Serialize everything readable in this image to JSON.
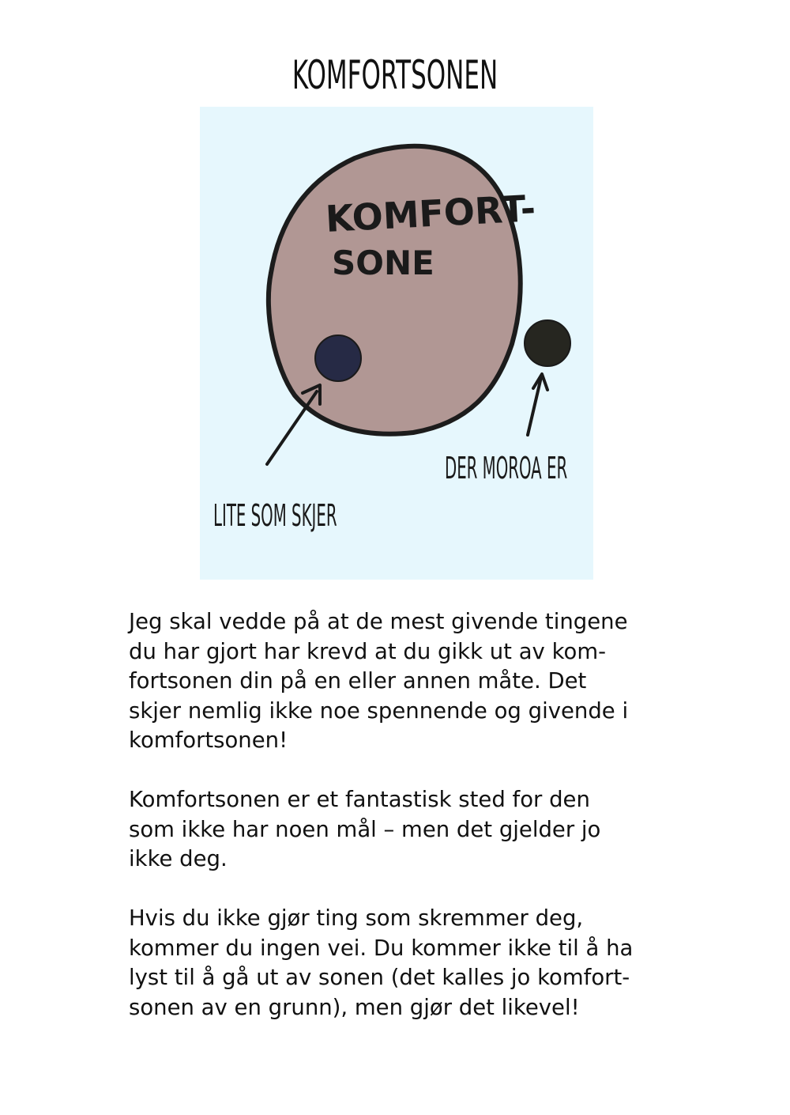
{
  "page": {
    "title": "KOMFORTSONEN"
  },
  "diagram": {
    "background_color": "#e6f7fd",
    "zone_fill_color": "#b19794",
    "zone_label_line1": "KOMFORT-",
    "zone_label_line2": "SONE",
    "inner_dot_color": "#262a45",
    "outer_dot_color": "#262620",
    "label_inside": "LITE SOM SKJER",
    "label_outside": "DER MOROA ER"
  },
  "body": {
    "paragraphs": [
      {
        "lines": [
          "Jeg skal vedde på at de mest givende tingene",
          "du har gjort har krevd at du gikk ut av kom-",
          "fortsonen din på en eller annen måte. Det",
          "skjer nemlig ikke noe spennende og givende i",
          "komfortsonen!"
        ]
      },
      {
        "lines": [
          "Komfortsonen er et fantastisk sted for den",
          "som ikke har noen mål – men det gjelder jo",
          "ikke deg."
        ]
      },
      {
        "lines": [
          "Hvis du ikke gjør ting som skremmer deg,",
          "kommer du ingen vei. Du kommer ikke til å ha",
          "lyst til å gå ut av sonen (det kalles jo komfort-",
          "sonen av en grunn), men gjør det likevel!"
        ]
      }
    ]
  }
}
